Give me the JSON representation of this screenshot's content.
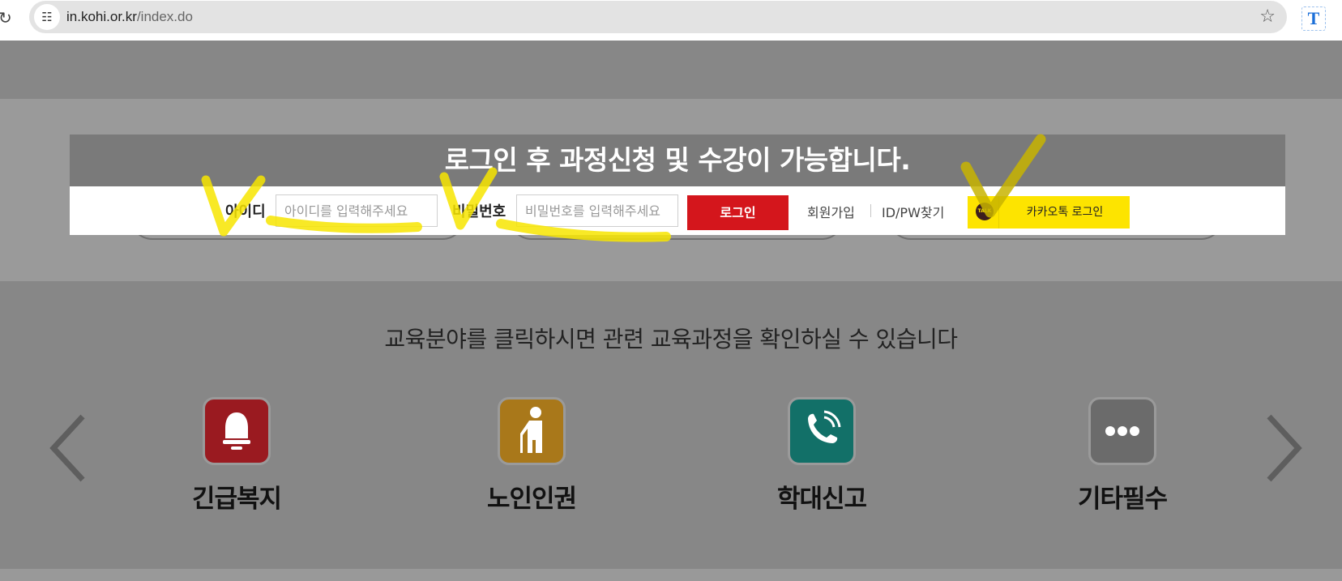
{
  "browser": {
    "url_host": "in.kohi.or.kr",
    "url_path": "/index.do",
    "extension_label": "T"
  },
  "login": {
    "notice": "로그인 후 과정신청 및 수강이 가능합니다.",
    "id_label": "아이디",
    "id_placeholder": "아이디를 입력해주세요",
    "pw_label": "비밀번호",
    "pw_placeholder": "비밀번호를 입력해주세요",
    "login_button": "로그인",
    "signup_link": "회원가입",
    "find_link": "ID/PW찾기",
    "kakao_button": "카카오톡 로그인",
    "kakao_icon_text": "TALK"
  },
  "categories": {
    "subtitle": "교육분야를 클릭하시면 관련 교육과정을 확인하실 수 있습니다",
    "items": [
      {
        "label": "긴급복지",
        "icon": "bell-icon",
        "color": "#9a1a20"
      },
      {
        "label": "노인인권",
        "icon": "elderly-person-icon",
        "color": "#a9781a"
      },
      {
        "label": "학대신고",
        "icon": "phone-call-icon",
        "color": "#127068"
      },
      {
        "label": "기타필수",
        "icon": "more-dots-icon",
        "color": "#6b6b6b"
      }
    ]
  },
  "colors": {
    "login_button": "#d4161c",
    "kakao": "#fde400",
    "highlighter": "#f7e500"
  }
}
